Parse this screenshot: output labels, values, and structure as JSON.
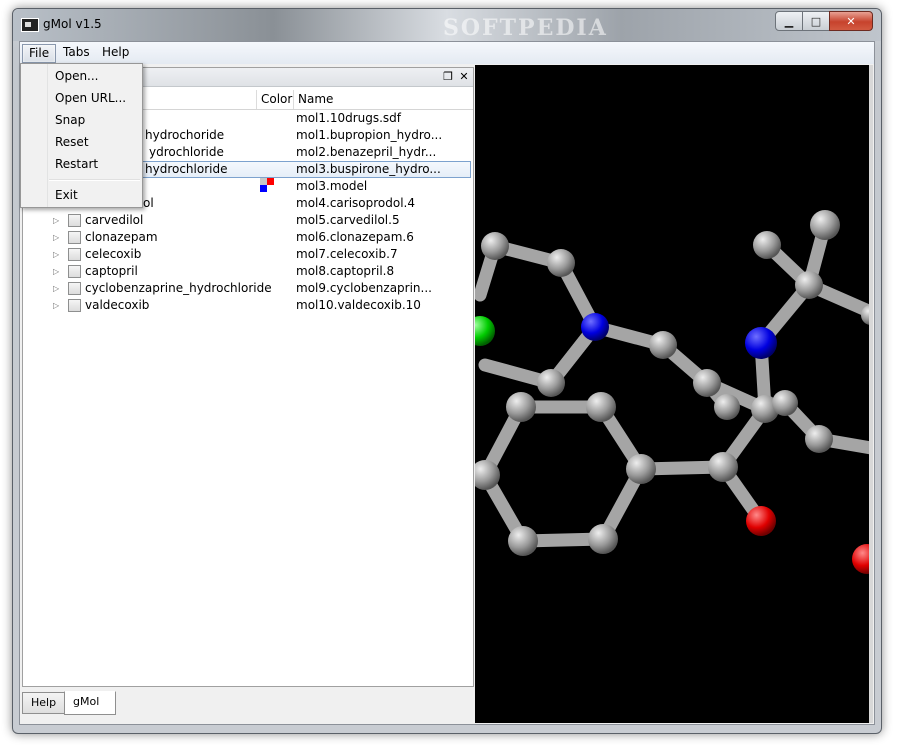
{
  "window": {
    "title": "gMol v1.5",
    "watermark": "SOFTPEDIA",
    "controls": {
      "minimize": "▁",
      "maximize": "□",
      "close": "✕"
    }
  },
  "menubar": {
    "file": "File",
    "tabs": "Tabs",
    "help": "Help"
  },
  "file_menu": {
    "open": "Open...",
    "open_url": "Open URL...",
    "snap": "Snap",
    "reset": "Reset",
    "restart": "Restart",
    "exit": "Exit"
  },
  "panel": {
    "float_icon": "❐",
    "close_icon": "✕"
  },
  "tree": {
    "columns": {
      "color": "Color",
      "name": "Name"
    },
    "rows": [
      {
        "label": "",
        "name": "mol1.10drugs.sdf"
      },
      {
        "label": "hydrochoride",
        "name": "mol1.bupropion_hydro..."
      },
      {
        "label": "ydrochloride",
        "name": "mol2.benazepril_hydr..."
      },
      {
        "label": "hydrochloride",
        "name": "mol3.buspirone_hydro..."
      },
      {
        "label": "",
        "name": "mol3.model"
      },
      {
        "label": "ol",
        "name": "mol4.carisoprodol.4"
      },
      {
        "label": "carvedilol",
        "name": "mol5.carvedilol.5"
      },
      {
        "label": "clonazepam",
        "name": "mol6.clonazepam.6"
      },
      {
        "label": "celecoxib",
        "name": "mol7.celecoxib.7"
      },
      {
        "label": "captopril",
        "name": "mol8.captopril.8"
      },
      {
        "label": "cyclobenzaprine_hydrochloride",
        "name": "mol9.cyclobenzaprin..."
      },
      {
        "label": "valdecoxib",
        "name": "mol10.valdecoxib.10"
      }
    ],
    "swatch_colors": [
      "#ff0000",
      "#0000ff",
      "#c8c8c8"
    ]
  },
  "bottom_tabs": {
    "help": "Help",
    "gmol": "gMol"
  },
  "atom_colors": {
    "carbon": "#9a9a9a",
    "nitrogen": "#0000e0",
    "oxygen": "#e00000",
    "chlorine": "#00cc00",
    "background": "#000000"
  }
}
